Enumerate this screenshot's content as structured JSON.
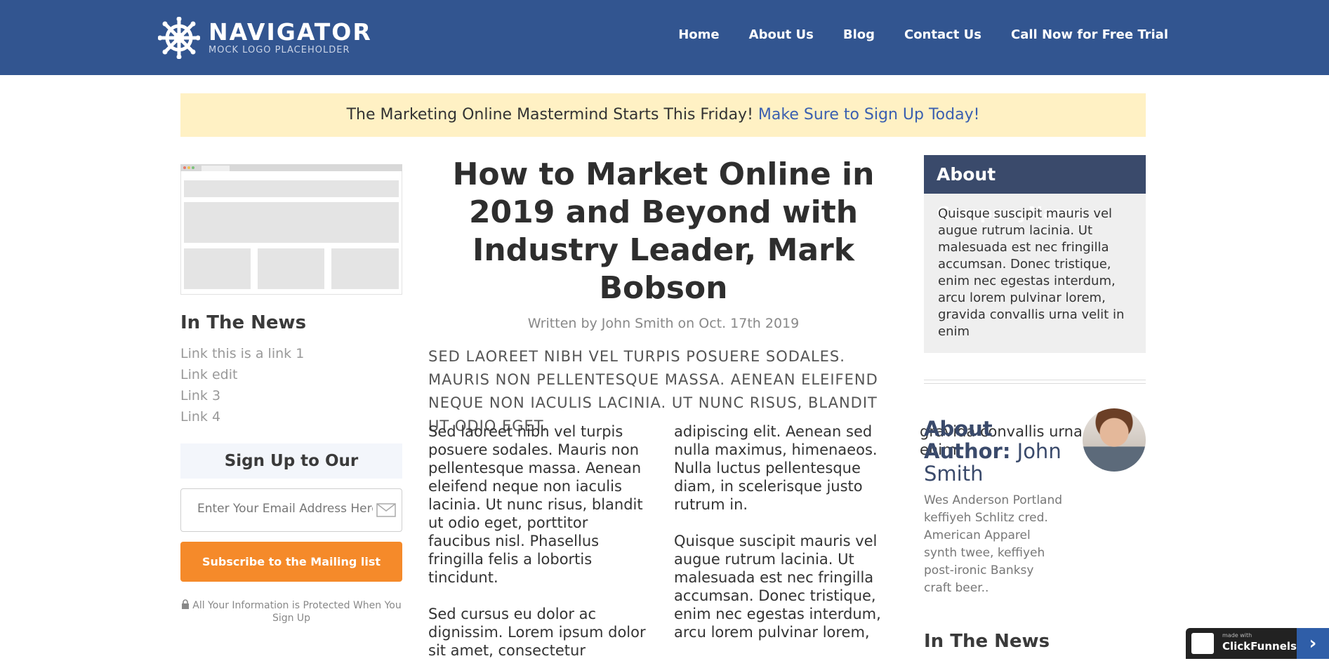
{
  "header": {
    "logo_title": "NAVIGATOR",
    "logo_subtitle": "MOCK LOGO PLACEHOLDER",
    "nav": [
      "Home",
      "About Us",
      "Blog",
      "Contact Us",
      "Call Now for Free Trial"
    ]
  },
  "banner": {
    "text": "The Marketing Online Mastermind Starts This Friday!",
    "link": "Make Sure to Sign Up Today!"
  },
  "left": {
    "news_heading": "In The News",
    "news_links": [
      "Link this is a link 1",
      "Link edit",
      "Link 3",
      "Link 4"
    ],
    "newsletter_heading": "Sign Up to Our Newsletter",
    "email_placeholder": "Enter Your Email Address Here...",
    "subscribe_label": "Subscribe to the Mailing list",
    "secure_text": "All Your Information is Protected When You Sign Up"
  },
  "article": {
    "title": "How to Market Online in 2019 and Beyond with Industry Leader, Mark Bobson",
    "byline": "Written by John Smith on Oct. 17th 2019",
    "lede": "SED LAOREET NIBH VEL TURPIS POSUERE SODALES. MAURIS NON PELLENTESQUE MASSA. AENEAN ELEIFEND NEQUE NON IACULIS LACINIA. UT NUNC RISUS, BLANDIT UT ODIO EGET.",
    "paragraphs": [
      "Sed laoreet nibh vel turpis posuere sodales. Mauris non pellentesque massa. Aenean eleifend neque non iaculis lacinia. Ut nunc risus, blandit ut odio eget, porttitor faucibus nisl. Phasellus fringilla felis a lobortis tincidunt.",
      "Sed cursus eu dolor ac dignissim. Lorem ipsum dolor sit amet, consectetur adipiscing elit. Aenean sed nulla maximus, himenaeos. Nulla luctus pellentesque diam, in scelerisque justo rutrum in.",
      "Quisque suscipit mauris vel augue rutrum lacinia. Ut malesuada est nec fringilla accumsan. Donec tristique, enim nec egestas interdum, arcu lorem pulvinar lorem, gravida convallis urna velit in enim."
    ]
  },
  "right": {
    "about_heading": "About CompanyName",
    "about_text": "Quisque suscipit mauris vel augue rutrum lacinia. Ut malesuada est nec fringilla accumsan. Donec tristique, enim nec egestas interdum, arcu lorem pulvinar lorem, gravida convallis urna velit in enim",
    "author_label": "About Author:",
    "author_name": "John Smith",
    "author_bio": "Wes Anderson Portland keffiyeh Schlitz cred. American Apparel synth twee, keffiyeh post-ironic Banksy craft beer..",
    "news_heading": "In The News"
  },
  "badge": {
    "small": "made with",
    "big": "ClickFunnels",
    "arrow": "›"
  },
  "colors": {
    "header_bg": "#325590",
    "banner_bg": "#fff1c4",
    "accent_orange": "#f58a2a",
    "about_heading_bg": "#3a4a6b"
  }
}
